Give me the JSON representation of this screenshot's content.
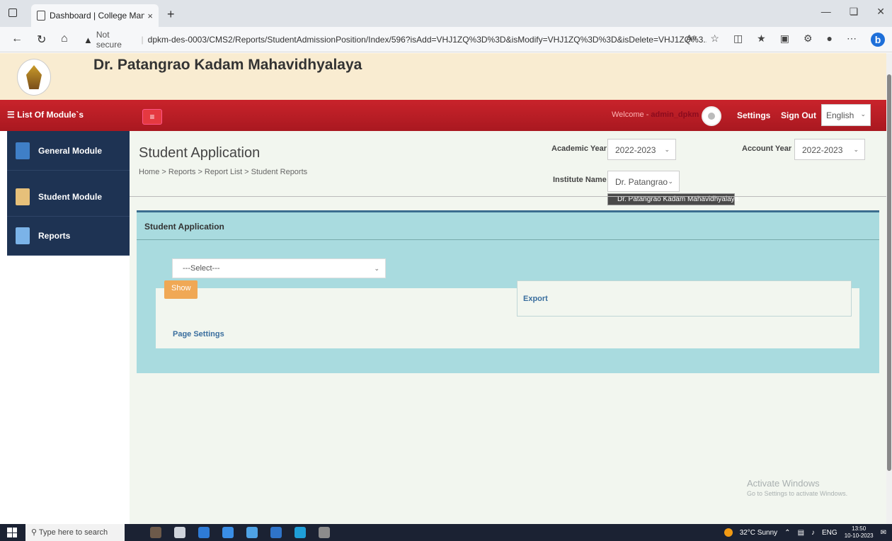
{
  "browser": {
    "tab_title": "Dashboard | College Management",
    "tab_close": "×",
    "new_tab": "+",
    "security": "Not secure",
    "url": "dpkm-des-0003/CMS2/Reports/StudentAdmissionPosition/Index/596?isAdd=VHJ1ZQ%3D%3D&isModify=VHJ1ZQ%3D%3D&isDelete=VHJ1ZQ%3...",
    "reader_label": "Aᵃ"
  },
  "site": {
    "college_name": "Dr. Patangrao Kadam Mahavidhyalaya"
  },
  "nav": {
    "module_list": "List Of Module`s",
    "hamburger": "≡",
    "welcome_prefix": "Welcome - ",
    "welcome_user": "admin_dpkm",
    "settings": "Settings",
    "sign_out": "Sign Out",
    "language": "English"
  },
  "sidebar": {
    "items": [
      {
        "label": "General Module",
        "icon_color": "#3f7fc7"
      },
      {
        "label": "Student Module",
        "icon_color": "#e6c07a"
      },
      {
        "label": "Reports",
        "icon_color": "#7bb3e8"
      }
    ]
  },
  "main": {
    "title": "Student Application",
    "breadcrumb": "Home > Reports > Report List > Student Reports",
    "academic_year_label": "Academic Year",
    "academic_year_value": "2022-2023",
    "account_year_label": "Account Year",
    "account_year_value": "2022-2023",
    "institute_label": "Institute Name",
    "institute_value": "Dr. Patangrao",
    "institute_option": "Dr. Patangrao Kadam Mahavidhyalaya",
    "panel_title": "Student Application",
    "select_placeholder": "---Select---",
    "show_button": "Show",
    "export_label": "Export",
    "page_settings": "Page Settings"
  },
  "watermark": {
    "line1": "Activate Windows",
    "line2": "Go to Settings to activate Windows."
  },
  "taskbar": {
    "search_placeholder": "Type here to search",
    "weather": "32°C  Sunny",
    "lang": "ENG",
    "time": "13:50",
    "date": "10-10-2023"
  },
  "colors": {
    "header_red": "#c9232b",
    "sidebar_navy": "#1e3353",
    "panel_teal": "#a9dbdf",
    "show_orange": "#f0a855",
    "header_cream": "#f9ecd1"
  }
}
